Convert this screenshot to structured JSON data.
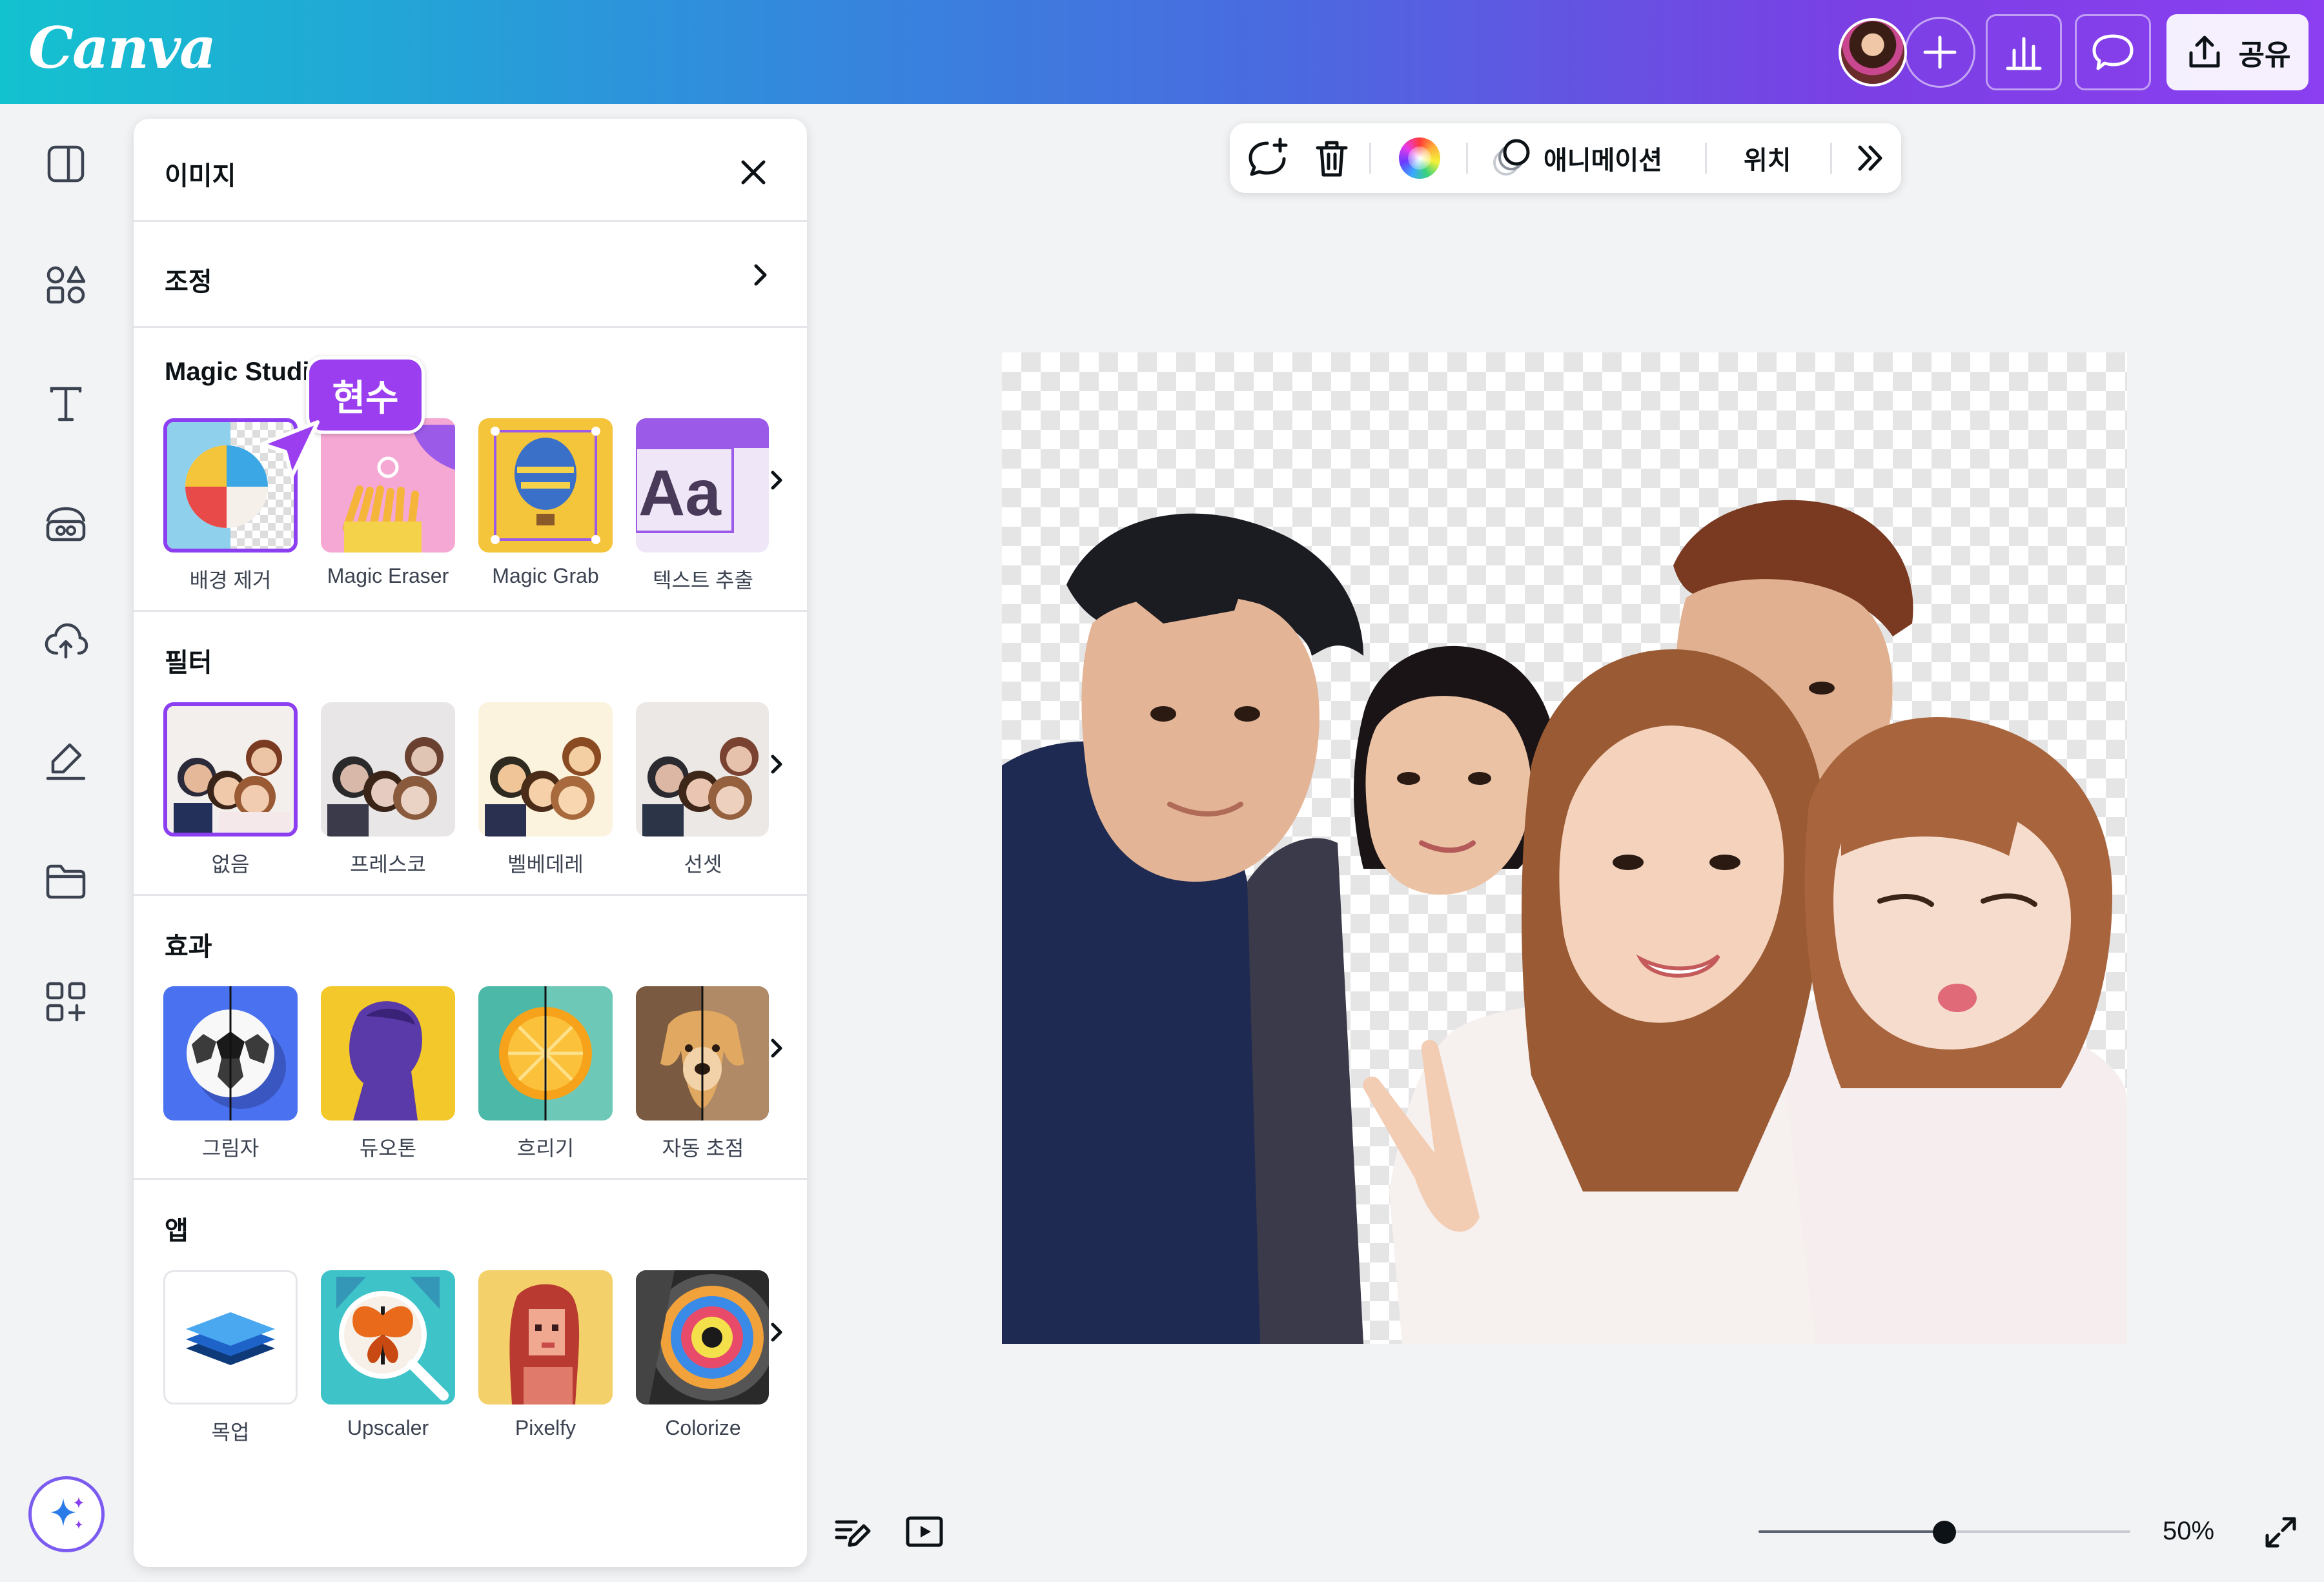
{
  "app": {
    "logo": "Canva"
  },
  "header": {
    "share_label": "공유",
    "icons": [
      "user-avatar",
      "plus-icon",
      "bar-chart-icon",
      "comment-icon",
      "upload-icon"
    ]
  },
  "rail": {
    "icons": [
      "layout-icon",
      "elements-icon",
      "text-icon",
      "brand-icon",
      "upload-cloud-icon",
      "draw-icon",
      "folder-icon",
      "apps-icon",
      "magic-sparkle-icon"
    ]
  },
  "panel": {
    "title": "이미지",
    "adjust_label": "조정",
    "tooltip_label": "현수",
    "magic_studio": {
      "title": "Magic Studio",
      "items": [
        {
          "label": "배경 제거",
          "selected": true
        },
        {
          "label": "Magic Eraser",
          "selected": false
        },
        {
          "label": "Magic Grab",
          "selected": false
        },
        {
          "label": "텍스트 추출",
          "selected": false
        }
      ]
    },
    "filters": {
      "title": "필터",
      "items": [
        {
          "label": "없음",
          "selected": true
        },
        {
          "label": "프레스코",
          "selected": false
        },
        {
          "label": "벨베데레",
          "selected": false
        },
        {
          "label": "선셋",
          "selected": false
        }
      ]
    },
    "effects": {
      "title": "효과",
      "items": [
        {
          "label": "그림자"
        },
        {
          "label": "듀오톤"
        },
        {
          "label": "흐리기"
        },
        {
          "label": "자동 초점"
        }
      ]
    },
    "apps": {
      "title": "앱",
      "items": [
        {
          "label": "목업"
        },
        {
          "label": "Upscaler"
        },
        {
          "label": "Pixelfy"
        },
        {
          "label": "Colorize"
        }
      ]
    }
  },
  "toolbar": {
    "animation_label": "애니메이션",
    "position_label": "위치"
  },
  "bottom": {
    "zoom_label": "50%",
    "zoom_fraction": 0.5
  },
  "colors": {
    "accent": "#8b3ff0",
    "header_gradient_start": "#13c2cf",
    "header_gradient_end": "#8b3ff0"
  }
}
